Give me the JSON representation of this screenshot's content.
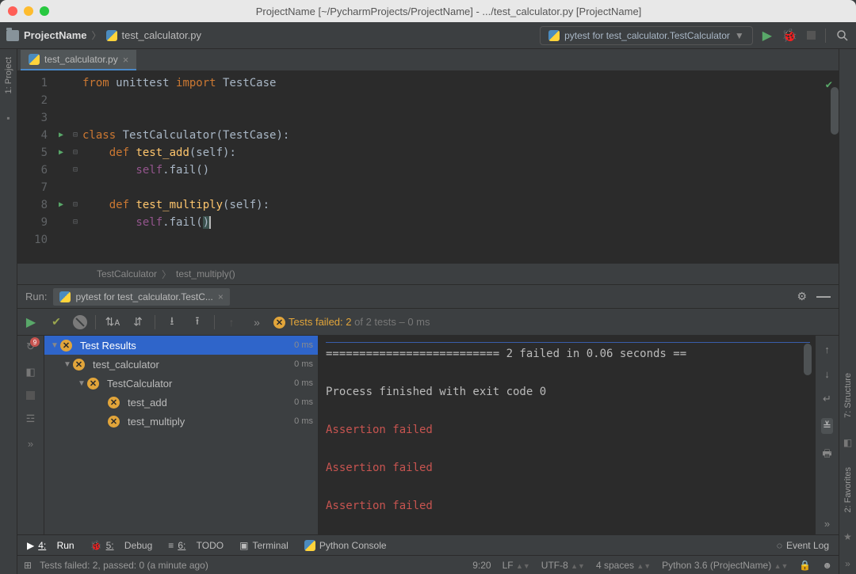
{
  "titlebar": {
    "text": "ProjectName [~/PycharmProjects/ProjectName] - .../test_calculator.py [ProjectName]"
  },
  "nav": {
    "project": "ProjectName",
    "file": "test_calculator.py",
    "run_config": "pytest for test_calculator.TestCalculator"
  },
  "left_gutter": {
    "project": "1: Project",
    "structure": "7: Structure",
    "favorites": "2: Favorites"
  },
  "tab": {
    "label": "test_calculator.py"
  },
  "editor": {
    "lines": [
      "1",
      "2",
      "3",
      "4",
      "5",
      "6",
      "7",
      "8",
      "9",
      "10"
    ]
  },
  "code": {
    "l1_from": "from ",
    "l1_mod": "unittest ",
    "l1_import": "import ",
    "l1_tc": "TestCase",
    "l4_class": "class ",
    "l4_name": "TestCalculator",
    "l4_tail": "(TestCase):",
    "l5_def": "    def ",
    "l5_name": "test_add",
    "l5_tail": "(self):",
    "l6_self": "        self",
    "l6_fail": ".fail()",
    "l8_def": "    def ",
    "l8_name": "test_multiply",
    "l8_tail": "(self):",
    "l9_self": "        self",
    "l9_fail": ".fail(",
    "l9_close": ")"
  },
  "crumbs": {
    "a": "TestCalculator",
    "b": "test_multiply()"
  },
  "run_panel": {
    "header_label": "Run:",
    "tab": "pytest for test_calculator.TestC...",
    "summary_fail": "Tests failed: 2",
    "summary_rest": " of 2 tests",
    "summary_time": " – 0 ms"
  },
  "tree": {
    "root": {
      "label": "Test Results",
      "time": "0 ms"
    },
    "items": [
      {
        "label": "test_calculator",
        "time": "0 ms"
      },
      {
        "label": "TestCalculator",
        "time": "0 ms"
      },
      {
        "label": "test_add",
        "time": "0 ms"
      },
      {
        "label": "test_multiply",
        "time": "0 ms"
      }
    ]
  },
  "console": {
    "hr": "========================== 2 failed in 0.06 seconds ==",
    "exit": "Process finished with exit code 0",
    "a1": "Assertion failed",
    "a2": "Assertion failed",
    "a3": "Assertion failed"
  },
  "bottom": {
    "run": "Run",
    "run_n": "4:",
    "debug": "Debug",
    "debug_n": "5:",
    "todo": "TODO",
    "todo_n": "6:",
    "terminal": "Terminal",
    "pyconsole": "Python Console",
    "eventlog": "Event Log"
  },
  "status": {
    "msg": "Tests failed: 2, passed: 0 (a minute ago)",
    "pos": "9:20",
    "le": "LF",
    "enc": "UTF-8",
    "indent": "4 spaces",
    "sdk": "Python 3.6 (ProjectName)"
  },
  "fail_count": "9"
}
